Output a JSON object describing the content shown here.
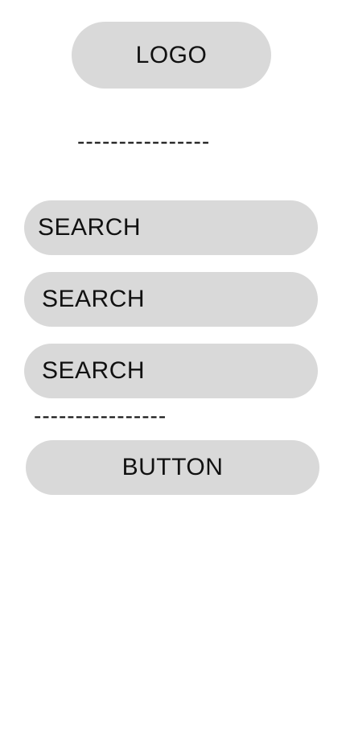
{
  "header": {
    "logo_text": "LOGO",
    "divider_text": "----------------"
  },
  "search_fields": [
    {
      "placeholder": "SEARCH"
    },
    {
      "placeholder": "SEARCH"
    },
    {
      "placeholder": "SEARCH"
    }
  ],
  "form": {
    "divider_text": "----------------",
    "button_label": "BUTTON"
  }
}
